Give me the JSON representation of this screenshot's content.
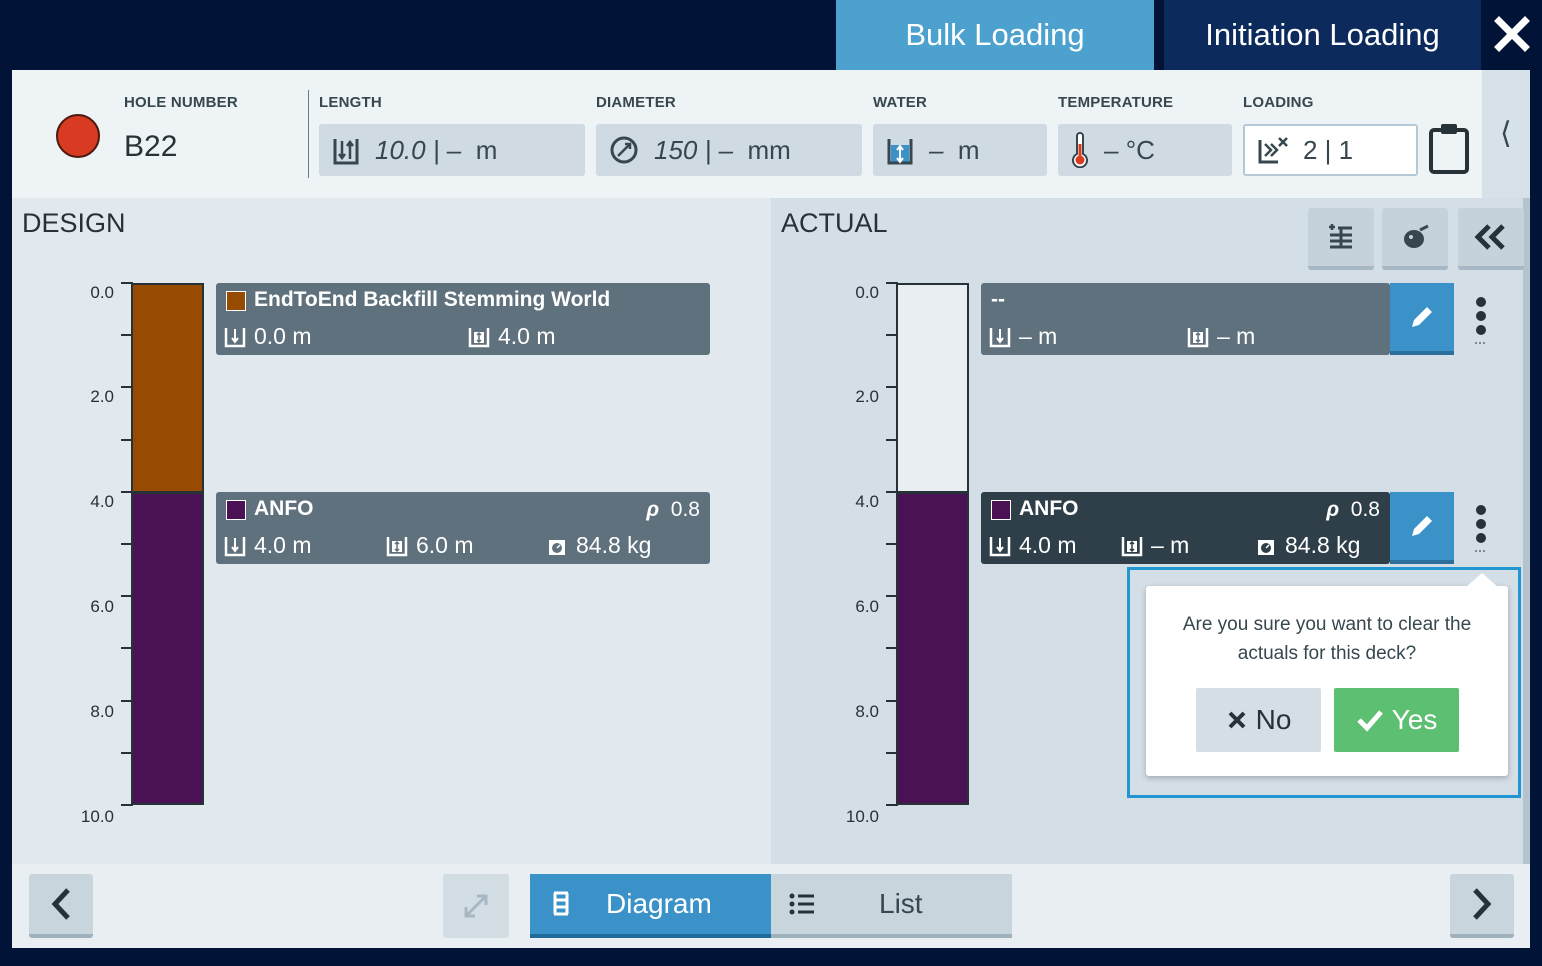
{
  "tabs": {
    "bulk": "Bulk Loading",
    "initiation": "Initiation Loading"
  },
  "header": {
    "hole_number_label": "HOLE NUMBER",
    "hole_number": "B22",
    "status_color": "#d83a22",
    "length_label": "LENGTH",
    "length_value": "10.0 | –",
    "length_unit": "m",
    "diameter_label": "DIAMETER",
    "diameter_value": "150 | –",
    "diameter_unit": "mm",
    "water_label": "WATER",
    "water_value": "–",
    "water_unit": "m",
    "temperature_label": "TEMPERATURE",
    "temperature_value": "–",
    "temperature_unit": "°C",
    "loading_label": "LOADING",
    "loading_value": "2 | 1",
    "collapse_glyph": "⟨"
  },
  "design": {
    "title": "DESIGN",
    "axis": [
      "0.0",
      "2.0",
      "4.0",
      "6.0",
      "8.0",
      "10.0"
    ],
    "decks": [
      {
        "name": "EndToEnd Backfill Stemming World",
        "color": "#964b00",
        "from": "0.0 m",
        "length": "4.0 m"
      },
      {
        "name": "ANFO",
        "color": "#4a1254",
        "rho_label": "ρ",
        "rho": "0.8",
        "from": "4.0 m",
        "length": "6.0 m",
        "mass": "84.8 kg"
      }
    ]
  },
  "actual": {
    "title": "ACTUAL",
    "axis": [
      "0.0",
      "2.0",
      "4.0",
      "6.0",
      "8.0",
      "10.0"
    ],
    "decks": [
      {
        "name": "--",
        "from": "– m",
        "length": "– m"
      },
      {
        "name": "ANFO",
        "color": "#4a1254",
        "rho_label": "ρ",
        "rho": "0.8",
        "from": "4.0 m",
        "length": "– m",
        "mass": "84.8 kg"
      }
    ]
  },
  "confirm": {
    "message": "Are you sure you want to clear the actuals for this deck?",
    "no_label": "No",
    "yes_label": "Yes"
  },
  "bottom": {
    "diagram_label": "Diagram",
    "list_label": "List"
  },
  "colors": {
    "accent": "#4ca1cf",
    "navy": "#021338",
    "confirm_green": "#5cbf72",
    "stemming": "#964b00",
    "anfo": "#4a1254"
  }
}
